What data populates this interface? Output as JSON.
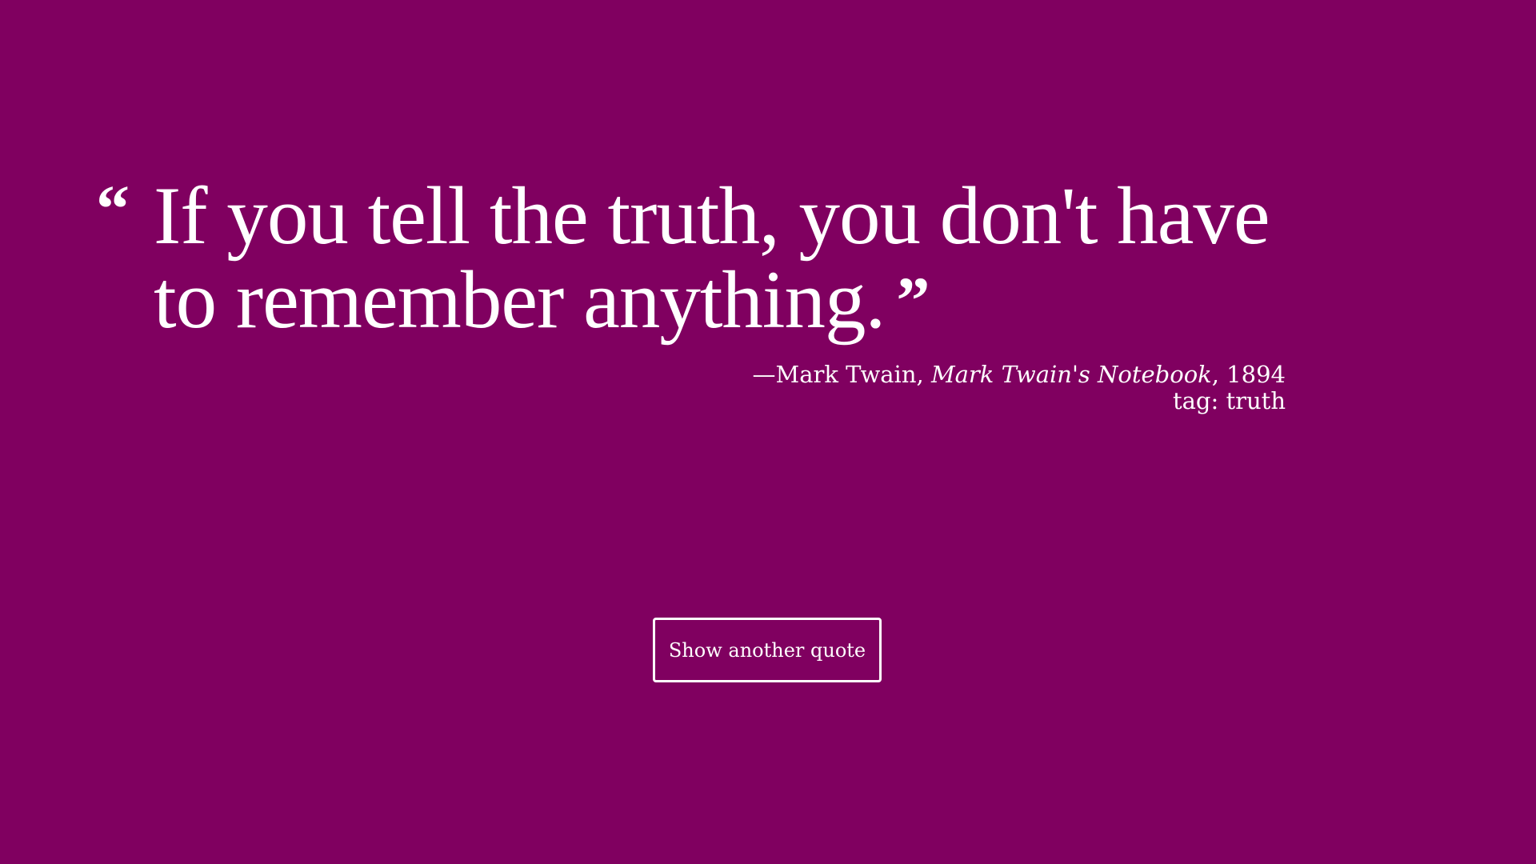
{
  "quote": {
    "open_mark": "“",
    "text": "If you tell the truth, you don't have to remember anything.",
    "close_mark": "”"
  },
  "attribution": {
    "dash_author": "—Mark Twain, ",
    "source": "Mark Twain's Notebook",
    "year": ", 1894",
    "tag": "tag: truth"
  },
  "button": {
    "label": "Show another quote"
  },
  "colors": {
    "background": "#800060",
    "text": "#ffffff"
  }
}
